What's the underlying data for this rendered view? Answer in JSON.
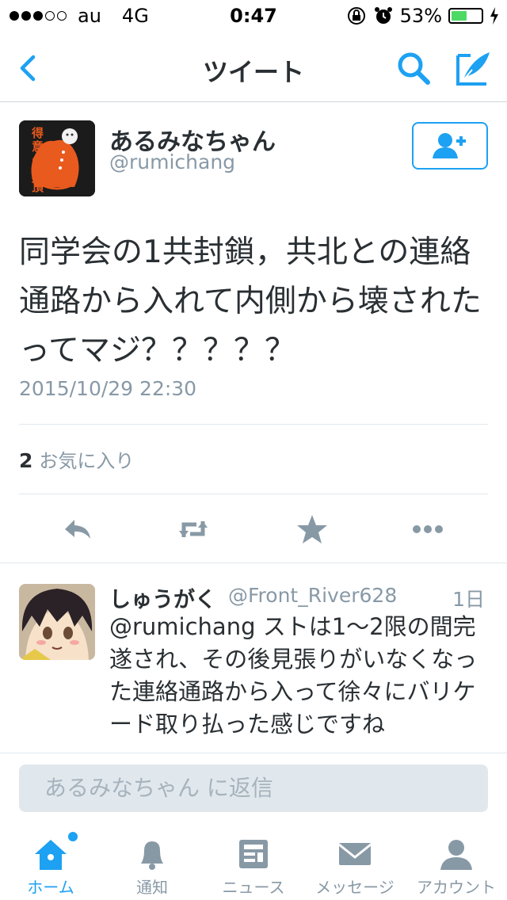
{
  "status_bar": {
    "carrier": "au",
    "network": "4G",
    "time": "0:47",
    "battery_percent": "53%",
    "battery_level": 0.53,
    "signal_bars": 3
  },
  "navbar": {
    "title": "ツイート",
    "icons": [
      "back-icon",
      "search-icon",
      "compose-icon"
    ]
  },
  "tweet": {
    "author_name": "あるみなちゃん",
    "author_handle": "@rumichang",
    "avatar_text": "得意の絶頂",
    "text": "同学会の1共封鎖，共北との連絡通路から入れて内側から壊されたってマジ？？？？？",
    "datetime": "2015/10/29 22:30",
    "fav_count": "2",
    "fav_label": "お気に入り",
    "actions": [
      "reply-icon",
      "retweet-icon",
      "favorite-icon",
      "more-icon"
    ]
  },
  "reply": {
    "author_name": "しゅうがく",
    "author_handle": "@Front_River628",
    "time": "1日",
    "text": "@rumichang ストは1〜2限の間完遂され、その後見張りがいなくなった連絡通路から入って徐々にバリケード取り払った感じですね"
  },
  "reply_box": {
    "placeholder": "あるみなちゃん に返信"
  },
  "tabbar": {
    "tabs": [
      {
        "label": "ホーム",
        "icon": "home-icon",
        "active": true
      },
      {
        "label": "通知",
        "icon": "bell-icon",
        "active": false
      },
      {
        "label": "ニュース",
        "icon": "news-icon",
        "active": false
      },
      {
        "label": "メッセージ",
        "icon": "envelope-icon",
        "active": false
      },
      {
        "label": "アカウント",
        "icon": "person-icon",
        "active": false
      }
    ]
  },
  "colors": {
    "accent": "#1da1f2",
    "text": "#292f33",
    "secondary": "#8899a6"
  }
}
